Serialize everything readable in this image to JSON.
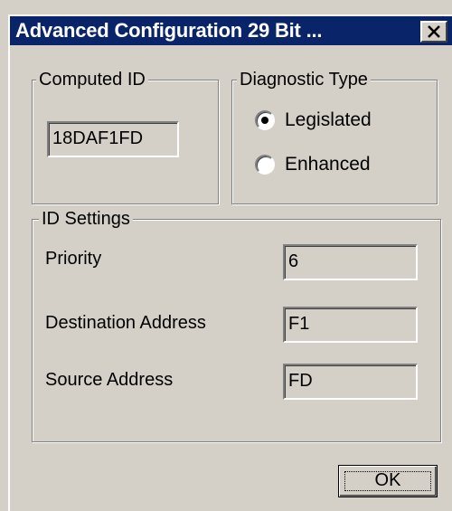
{
  "window": {
    "title": "Advanced Configuration 29 Bit ...",
    "close_icon": "close-icon"
  },
  "computed_id": {
    "legend": "Computed ID",
    "value": "18DAF1FD"
  },
  "diagnostic_type": {
    "legend": "Diagnostic Type",
    "options": [
      {
        "label": "Legislated",
        "selected": true
      },
      {
        "label": "Enhanced",
        "selected": false
      }
    ]
  },
  "id_settings": {
    "legend": "ID Settings",
    "fields": [
      {
        "label": "Priority",
        "value": "6"
      },
      {
        "label": "Destination Address",
        "value": "F1"
      },
      {
        "label": "Source Address",
        "value": "FD"
      }
    ]
  },
  "buttons": {
    "ok_label": "OK"
  },
  "colors": {
    "titlebar": "#0a246a",
    "face": "#d4d0c8"
  }
}
